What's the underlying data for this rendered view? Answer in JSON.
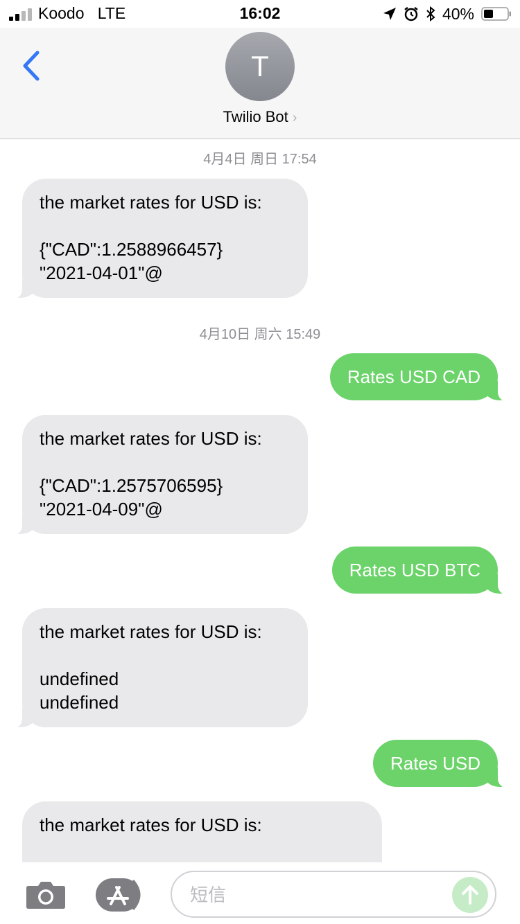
{
  "status_bar": {
    "carrier": "Koodo",
    "network": "LTE",
    "time": "16:02",
    "battery_percent": "40%"
  },
  "header": {
    "back_icon": "chevron-left-icon",
    "avatar_initial": "T",
    "contact_name": "Twilio Bot",
    "contact_chevron": "›"
  },
  "messages": {
    "timestamp_1": "4月4日 周日 17:54",
    "msg_1": "the market rates for USD is:\n\n{\"CAD\":1.2588966457}\n\"2021-04-01\"@",
    "timestamp_2": "4月10日 周六 15:49",
    "msg_2": "Rates USD CAD",
    "msg_3": "the market rates for USD is:\n\n{\"CAD\":1.2575706595}\n\"2021-04-09\"@",
    "msg_4": "Rates USD BTC",
    "msg_5": "the market rates for USD is:\n\nundefined\nundefined",
    "msg_6": "Rates USD",
    "msg_7": "the market rates for USD is:"
  },
  "composer": {
    "placeholder": "短信",
    "camera_icon": "camera-icon",
    "apps_icon": "app-store-icon",
    "send_icon": "arrow-up-icon"
  },
  "colors": {
    "accent_blue": "#3478f6",
    "bubble_outgoing": "#6cd36a",
    "bubble_incoming": "#e9e9eb",
    "send_inactive": "#c5ecc6"
  }
}
